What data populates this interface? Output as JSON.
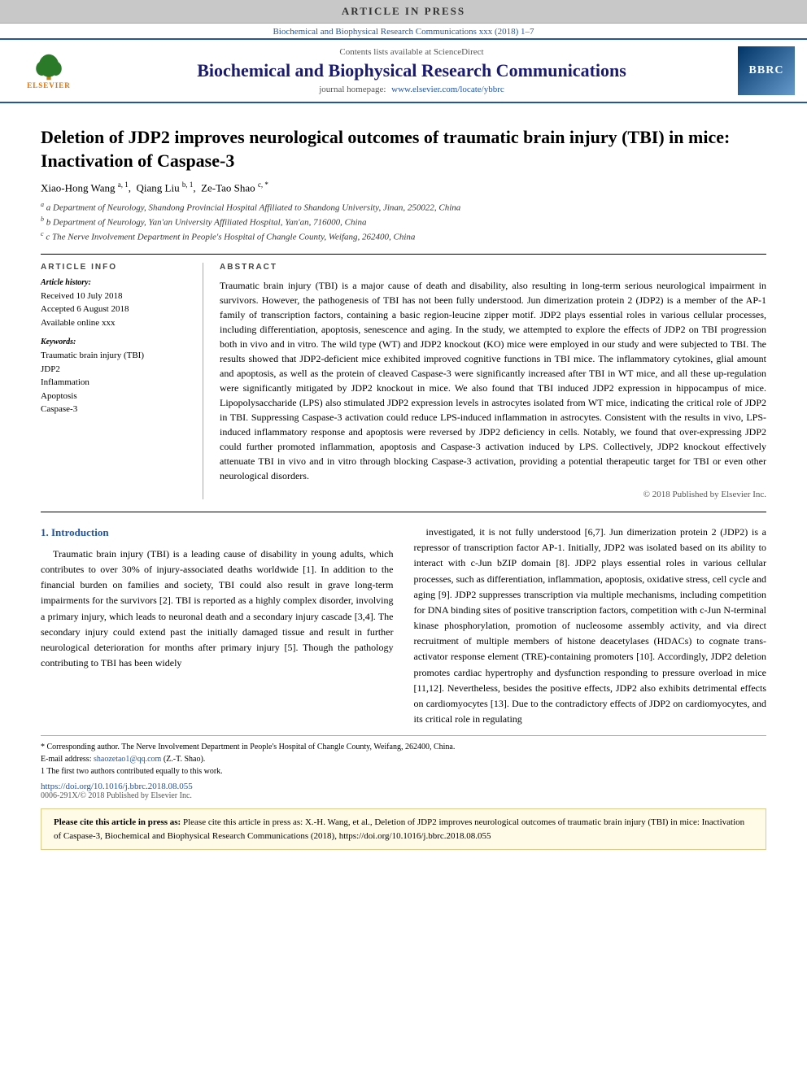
{
  "banner": {
    "text": "ARTICLE IN PRESS"
  },
  "journal_ref": {
    "text": "Biochemical and Biophysical Research Communications xxx (2018) 1–7"
  },
  "header": {
    "sciencedirect": "Contents lists available at ScienceDirect",
    "journal_title": "Biochemical and Biophysical Research Communications",
    "homepage_label": "journal homepage:",
    "homepage_url": "www.elsevier.com/locate/ybbrc",
    "bbrc_logo": "BBRC",
    "elsevier_label": "ELSEVIER"
  },
  "article": {
    "title": "Deletion of JDP2 improves neurological outcomes of traumatic brain injury (TBI) in mice: Inactivation of Caspase-3",
    "authors": "Xiao-Hong Wang a, 1, Qiang Liu b, 1, Ze-Tao Shao c, *",
    "affiliations": [
      "a Department of Neurology, Shandong Provincial Hospital Affiliated to Shandong University, Jinan, 250022, China",
      "b Department of Neurology, Yan'an University Affiliated Hospital, Yan'an, 716000, China",
      "c The Nerve Involvement Department in People's Hospital of Changle County, Weifang, 262400, China"
    ]
  },
  "article_info": {
    "heading": "ARTICLE INFO",
    "history_title": "Article history:",
    "received": "Received 10 July 2018",
    "accepted": "Accepted 6 August 2018",
    "available": "Available online xxx",
    "keywords_title": "Keywords:",
    "keywords": [
      "Traumatic brain injury (TBI)",
      "JDP2",
      "Inflammation",
      "Apoptosis",
      "Caspase-3"
    ]
  },
  "abstract": {
    "heading": "ABSTRACT",
    "text": "Traumatic brain injury (TBI) is a major cause of death and disability, also resulting in long-term serious neurological impairment in survivors. However, the pathogenesis of TBI has not been fully understood. Jun dimerization protein 2 (JDP2) is a member of the AP-1 family of transcription factors, containing a basic region-leucine zipper motif. JDP2 plays essential roles in various cellular processes, including differentiation, apoptosis, senescence and aging. In the study, we attempted to explore the effects of JDP2 on TBI progression both in vivo and in vitro. The wild type (WT) and JDP2 knockout (KO) mice were employed in our study and were subjected to TBI. The results showed that JDP2-deficient mice exhibited improved cognitive functions in TBI mice. The inflammatory cytokines, glial amount and apoptosis, as well as the protein of cleaved Caspase-3 were significantly increased after TBI in WT mice, and all these up-regulation were significantly mitigated by JDP2 knockout in mice. We also found that TBI induced JDP2 expression in hippocampus of mice. Lipopolysaccharide (LPS) also stimulated JDP2 expression levels in astrocytes isolated from WT mice, indicating the critical role of JDP2 in TBI. Suppressing Caspase-3 activation could reduce LPS-induced inflammation in astrocytes. Consistent with the results in vivo, LPS-induced inflammatory response and apoptosis were reversed by JDP2 deficiency in cells. Notably, we found that over-expressing JDP2 could further promoted inflammation, apoptosis and Caspase-3 activation induced by LPS. Collectively, JDP2 knockout effectively attenuate TBI in vivo and in vitro through blocking Caspase-3 activation, providing a potential therapeutic target for TBI or even other neurological disorders.",
    "copyright": "© 2018 Published by Elsevier Inc."
  },
  "intro": {
    "heading": "1. Introduction",
    "left_text": "Traumatic brain injury (TBI) is a leading cause of disability in young adults, which contributes to over 30% of injury-associated deaths worldwide [1]. In addition to the financial burden on families and society, TBI could also result in grave long-term impairments for the survivors [2]. TBI is reported as a highly complex disorder, involving a primary injury, which leads to neuronal death and a secondary injury cascade [3,4]. The secondary injury could extend past the initially damaged tissue and result in further neurological deterioration for months after primary injury [5]. Though the pathology contributing to TBI has been widely",
    "right_text": "investigated, it is not fully understood [6,7]. Jun dimerization protein 2 (JDP2) is a repressor of transcription factor AP-1. Initially, JDP2 was isolated based on its ability to interact with c-Jun bZIP domain [8]. JDP2 plays essential roles in various cellular processes, such as differentiation, inflammation, apoptosis, oxidative stress, cell cycle and aging [9]. JDP2 suppresses transcription via multiple mechanisms, including competition for DNA binding sites of positive transcription factors, competition with c-Jun N-terminal kinase phosphorylation, promotion of nucleosome assembly activity, and via direct recruitment of multiple members of histone deacetylases (HDACs) to cognate trans-activator response element (TRE)-containing promoters [10]. Accordingly, JDP2 deletion promotes cardiac hypertrophy and dysfunction responding to pressure overload in mice [11,12]. Nevertheless, besides the positive effects, JDP2 also exhibits detrimental effects on cardiomyocytes [13]. Due to the contradictory effects of JDP2 on cardiomyocytes, and its critical role in regulating"
  },
  "footnotes": {
    "corresponding": "* Corresponding author. The Nerve Involvement Department in People's Hospital of Changle County, Weifang, 262400, China.",
    "email_label": "E-mail address:",
    "email": "shaozetao1@qq.com",
    "email_name": "(Z.-T. Shao).",
    "equal_contrib": "1 The first two authors contributed equally to this work."
  },
  "doi": {
    "url": "https://doi.org/10.1016/j.bbrc.2018.08.055",
    "issn": "0006-291X/© 2018 Published by Elsevier Inc."
  },
  "citation": {
    "text": "Please cite this article in press as: X.-H. Wang, et al., Deletion of JDP2 improves neurological outcomes of traumatic brain injury (TBI) in mice: Inactivation of Caspase-3, Biochemical and Biophysical Research Communications (2018), https://doi.org/10.1016/j.bbrc.2018.08.055"
  }
}
